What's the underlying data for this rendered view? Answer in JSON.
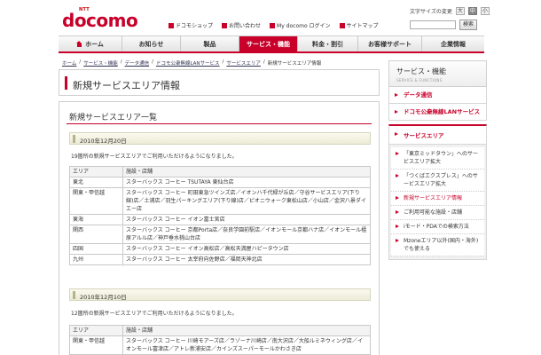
{
  "header": {
    "logo_ntt": "NTT",
    "logo_brand": "docomo",
    "font_size_label": "文字サイズの変更",
    "font_size_buttons": [
      "大",
      "中",
      "小"
    ],
    "links": [
      {
        "label": "ドコモショップ"
      },
      {
        "label": "お問い合わせ"
      },
      {
        "label": "My docomo ログイン"
      },
      {
        "label": "サイトマップ"
      }
    ],
    "search_button": "検索"
  },
  "gnav": {
    "tabs": [
      "ホーム",
      "お知らせ",
      "製品",
      "サービス・機能",
      "料金・割引",
      "お客様サポート",
      "企業情報"
    ],
    "active_index": 3
  },
  "breadcrumb": {
    "items": [
      "ホーム",
      "サービス・機能",
      "データ通信",
      "ドコモ公衆無線LANサービス",
      "サービスエリア",
      "新規サービスエリア情報"
    ],
    "sep": "/"
  },
  "main": {
    "page_title": "新規サービスエリア情報",
    "panel_heading": "新規サービスエリア一覧",
    "col_area": "エリア",
    "col_facility": "施設・店舗",
    "sections": [
      {
        "date": "2010年12月20日",
        "note": "19箇所の新規サービスエリアでご利用いただけるようになりました。",
        "rows": [
          {
            "area": "東北",
            "facility": "スターバックス コーヒー TSUTAYA 東仙台店"
          },
          {
            "area": "関東・甲信越",
            "facility": "スターバックス コーヒー 町田東急ツインズ店／イオンハ千代緑が丘店／守谷サービスエリア(下り線)店／土浦店／羽生パーキングエリア(下り線)店／ピオニウォーク東松山店／小山店／金沢八景ダイエー店"
          },
          {
            "area": "東海",
            "facility": "スターバックス コーヒー イオン富士宮店"
          },
          {
            "area": "関西",
            "facility": "スターバックス コーヒー 京都Porta店／奈良学園前駅店／イオンモール京都ハナ店／イオンモール橿原アルル店／神戸垂水桃山台店"
          },
          {
            "area": "四国",
            "facility": "スターバックス コーヒー イオン高松店／高松天満屋ハピータウン店"
          },
          {
            "area": "九州",
            "facility": "スターバックス コーヒー 太宰府向佐野店／福岡天神北店"
          }
        ]
      },
      {
        "date": "2010年12月10日",
        "note": "12箇所の新規サービスエリアでご利用いただけるようになりました。",
        "rows": [
          {
            "area": "関東・甲信越",
            "facility": "スターバックス コーヒー 川崎モアーズ店／ラゾーナ川崎店／南大沢店／大船ルミネウィング店／イオンモール富津店／アトレ新浦安店／カインズスーパーモールかわさき店"
          }
        ]
      }
    ]
  },
  "side": {
    "title": "サービス・機能",
    "subtitle": "SERVICE & FUNCTIONS",
    "cat_data": "データ通信",
    "cat_lan": "ドコモ公衆無線LANサービス",
    "cat_area": "サービスエリア",
    "items": [
      "「東京ミッドタウン」へのサービスエリア拡大",
      "「つくばエクスプレス」へのサービスエリア拡大",
      "新規サービスエリア情報",
      "ご利用可能な施設・店舗",
      "iモード・PDAでの検索方法",
      "Mzoneエリア以外(国内・海外)でも使える"
    ],
    "current_index": 2
  },
  "colors": {
    "brand_red": "#c8002a"
  }
}
